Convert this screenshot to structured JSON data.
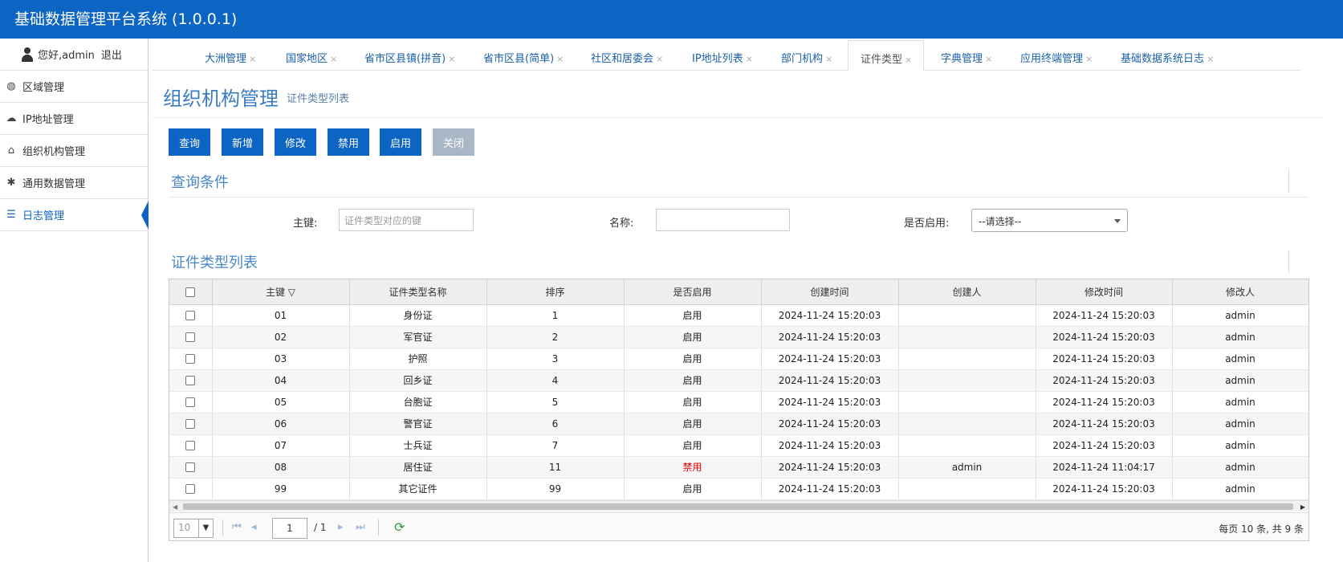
{
  "app": {
    "title": "基础数据管理平台系统 (1.0.0.1)"
  },
  "user": {
    "greeting": "您好,admin",
    "logout": "退出"
  },
  "sidebar": {
    "items": [
      {
        "label": "区域管理",
        "icon": "globe-icon"
      },
      {
        "label": "IP地址管理",
        "icon": "cloud-icon"
      },
      {
        "label": "组织机构管理",
        "icon": "home-icon"
      },
      {
        "label": "通用数据管理",
        "icon": "asterisk-icon"
      },
      {
        "label": "日志管理",
        "icon": "list-icon",
        "active": true
      }
    ]
  },
  "tabs": [
    {
      "label": "大洲管理"
    },
    {
      "label": "国家地区"
    },
    {
      "label": "省市区县镇(拼音)"
    },
    {
      "label": "省市区县(简单)"
    },
    {
      "label": "社区和居委会"
    },
    {
      "label": "IP地址列表"
    },
    {
      "label": "部门机构"
    },
    {
      "label": "证件类型",
      "active": true
    },
    {
      "label": "字典管理"
    },
    {
      "label": "应用终端管理"
    },
    {
      "label": "基础数据系统日志"
    }
  ],
  "tab_close": "×",
  "page": {
    "title": "组织机构管理",
    "subtitle": "证件类型列表"
  },
  "toolbar": {
    "query": "查询",
    "add": "新增",
    "edit": "修改",
    "disable": "禁用",
    "enable": "启用",
    "close": "关闭"
  },
  "query": {
    "title": "查询条件",
    "key_label": "主键:",
    "key_placeholder": "证件类型对应的键",
    "name_label": "名称:",
    "name_value": "",
    "enabled_label": "是否启用:",
    "enabled_value": "--请选择--"
  },
  "list": {
    "title": "证件类型列表",
    "headers": {
      "key": "主键 ▽",
      "name": "证件类型名称",
      "order": "排序",
      "enabled": "是否启用",
      "created_time": "创建时间",
      "creator": "创建人",
      "modified_time": "修改时间",
      "modifier": "修改人"
    },
    "rows": [
      {
        "key": "01",
        "name": "身份证",
        "order": "1",
        "enabled": "启用",
        "created_time": "2024-11-24 15:20:03",
        "creator": "",
        "modified_time": "2024-11-24 15:20:03",
        "modifier": "admin"
      },
      {
        "key": "02",
        "name": "军官证",
        "order": "2",
        "enabled": "启用",
        "created_time": "2024-11-24 15:20:03",
        "creator": "",
        "modified_time": "2024-11-24 15:20:03",
        "modifier": "admin"
      },
      {
        "key": "03",
        "name": "护照",
        "order": "3",
        "enabled": "启用",
        "created_time": "2024-11-24 15:20:03",
        "creator": "",
        "modified_time": "2024-11-24 15:20:03",
        "modifier": "admin"
      },
      {
        "key": "04",
        "name": "回乡证",
        "order": "4",
        "enabled": "启用",
        "created_time": "2024-11-24 15:20:03",
        "creator": "",
        "modified_time": "2024-11-24 15:20:03",
        "modifier": "admin"
      },
      {
        "key": "05",
        "name": "台胞证",
        "order": "5",
        "enabled": "启用",
        "created_time": "2024-11-24 15:20:03",
        "creator": "",
        "modified_time": "2024-11-24 15:20:03",
        "modifier": "admin"
      },
      {
        "key": "06",
        "name": "警官证",
        "order": "6",
        "enabled": "启用",
        "created_time": "2024-11-24 15:20:03",
        "creator": "",
        "modified_time": "2024-11-24 15:20:03",
        "modifier": "admin"
      },
      {
        "key": "07",
        "name": "士兵证",
        "order": "7",
        "enabled": "启用",
        "created_time": "2024-11-24 15:20:03",
        "creator": "",
        "modified_time": "2024-11-24 15:20:03",
        "modifier": "admin"
      },
      {
        "key": "08",
        "name": "居住证",
        "order": "11",
        "enabled": "禁用",
        "created_time": "2024-11-24 15:20:03",
        "creator": "admin",
        "modified_time": "2024-11-24 11:04:17",
        "modifier": "admin",
        "disabled": true
      },
      {
        "key": "99",
        "name": "其它证件",
        "order": "99",
        "enabled": "启用",
        "created_time": "2024-11-24 15:20:03",
        "creator": "",
        "modified_time": "2024-11-24 15:20:03",
        "modifier": "admin"
      }
    ]
  },
  "pager": {
    "page_size": "10",
    "page": "1",
    "total_pages": "/ 1",
    "info": "每页 10 条, 共 9 条"
  }
}
